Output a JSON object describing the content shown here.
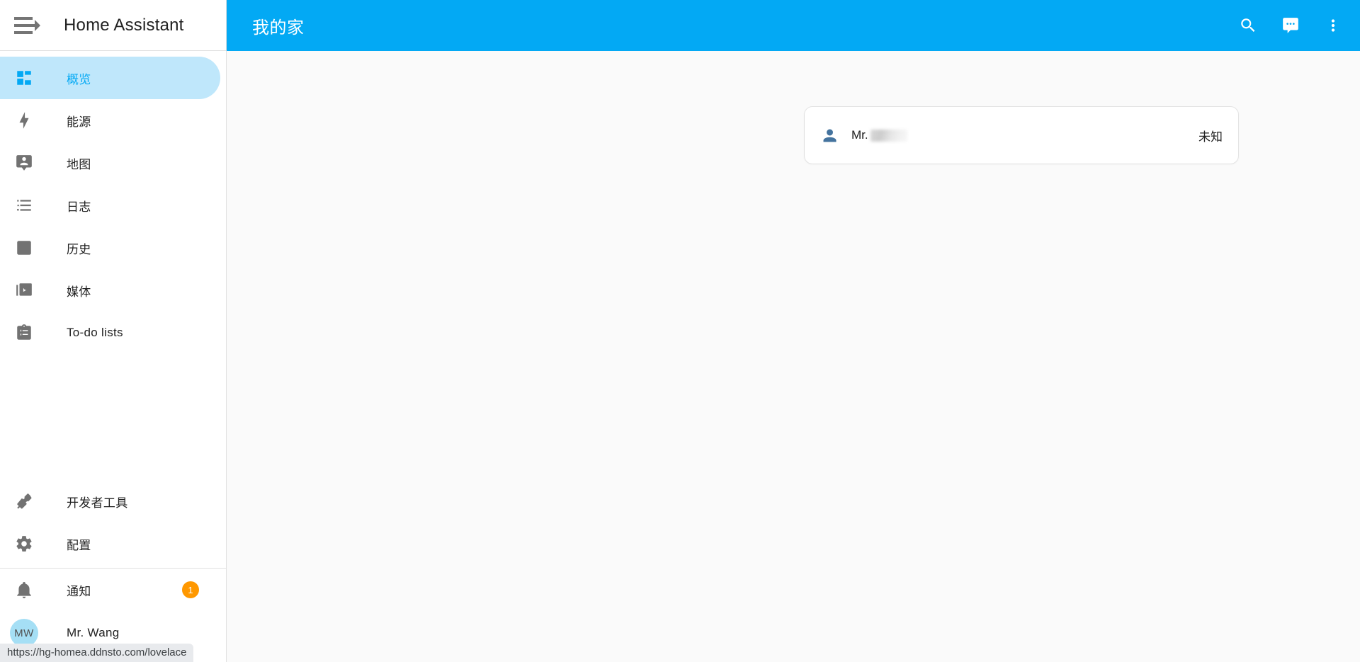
{
  "window": {
    "app_title": "Home Assistant",
    "status_url": "https://hg-homea.ddnsto.com/lovelace"
  },
  "colors": {
    "accent": "#03a9f4",
    "sidebar_selected_bg": "#bfe7fb",
    "badge": "#ff9800",
    "avatar_bg": "#a5dff5",
    "entity_icon": "#44739e",
    "main_bg": "#fafafa"
  },
  "sidebar": {
    "menu_button": "menu-open-icon",
    "items": [
      {
        "label": "概览",
        "icon": "view-dashboard-icon",
        "selected": true
      },
      {
        "label": "能源",
        "icon": "lightning-bolt-icon",
        "selected": false
      },
      {
        "label": "地图",
        "icon": "map-marker-account-icon",
        "selected": false
      },
      {
        "label": "日志",
        "icon": "format-list-bulleted-icon",
        "selected": false
      },
      {
        "label": "历史",
        "icon": "chart-box-icon",
        "selected": false
      },
      {
        "label": "媒体",
        "icon": "play-box-multiple-icon",
        "selected": false
      },
      {
        "label": "To-do lists",
        "icon": "clipboard-list-icon",
        "selected": false
      }
    ],
    "bottom_items": [
      {
        "label": "开发者工具",
        "icon": "hammer-icon"
      },
      {
        "label": "配置",
        "icon": "cog-icon"
      }
    ],
    "notifications": {
      "label": "通知",
      "icon": "bell-icon",
      "count": "1"
    },
    "user": {
      "name": "Mr. Wang",
      "initials": "MW"
    }
  },
  "toolbar": {
    "view_title": "我的家",
    "buttons": [
      {
        "name": "search",
        "icon": "search-icon"
      },
      {
        "name": "assist",
        "icon": "assist-chat-icon"
      },
      {
        "name": "overflow",
        "icon": "dots-vertical-icon"
      }
    ]
  },
  "main": {
    "card": {
      "entity": {
        "icon": "account-icon",
        "name_prefix": "Mr.",
        "name_redacted": true,
        "state": "未知"
      }
    }
  }
}
